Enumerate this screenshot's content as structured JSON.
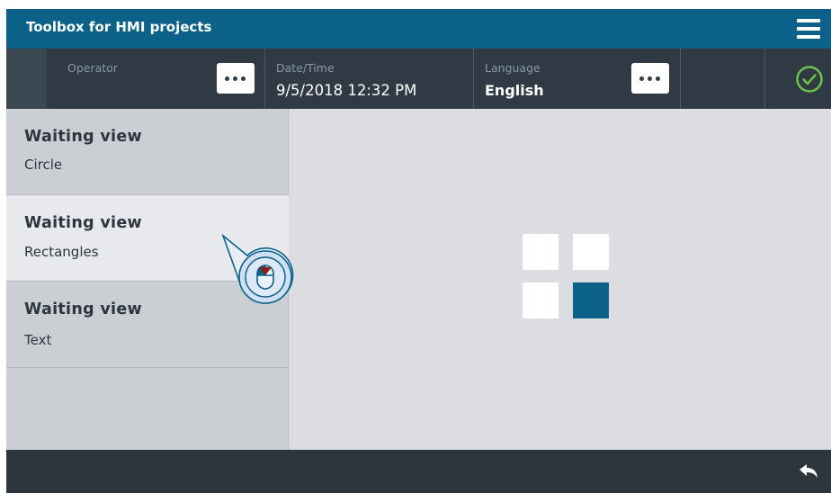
{
  "titlebar": {
    "title": "Toolbox for HMI projects",
    "menu_icon": "hamburger-menu-icon"
  },
  "header": {
    "operator_label": "Operator",
    "datetime_label": "Date/Time",
    "datetime_value": "9/5/2018 12:32 PM",
    "language_label": "Language",
    "language_value": "English",
    "status_icon": "check-circle-icon",
    "status_color": "#6cc24a"
  },
  "side_items": [
    {
      "title": "Waiting view",
      "subtitle": "Circle",
      "active": false
    },
    {
      "title": "Waiting view",
      "subtitle": "Rectangles",
      "active": true
    },
    {
      "title": "Waiting view",
      "subtitle": "Text",
      "active": false
    }
  ],
  "waiting_view": {
    "type": "rectangles",
    "squares": [
      "white",
      "white",
      "white",
      "accent"
    ],
    "accent_color": "#0b6188"
  },
  "footer": {
    "back_icon": "back-arrow-icon"
  },
  "colors": {
    "titlebar": "#0b6188",
    "header": "#2f3a44",
    "footer": "#2d353d",
    "content": "#dcdde1"
  }
}
